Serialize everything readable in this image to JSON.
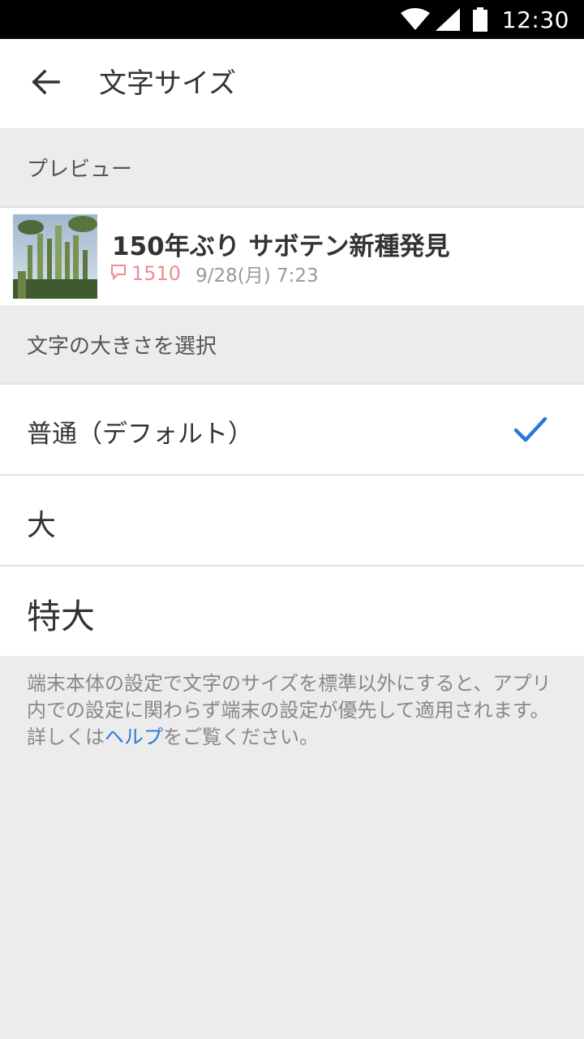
{
  "status_bar": {
    "time": "12:30",
    "icons": [
      "wifi-icon",
      "cell-signal-icon",
      "battery-icon"
    ]
  },
  "app_bar": {
    "back_icon": "arrow-left-icon",
    "title": "文字サイズ"
  },
  "preview_section": {
    "header": "プレビュー",
    "article": {
      "title": "150年ぶり サボテン新種発見",
      "comment_icon": "comment-icon",
      "comment_count": "1510",
      "date": "9/28(月) 7:23"
    }
  },
  "size_section": {
    "header": "文字の大きさを選択",
    "options": [
      {
        "label": "普通（デフォルト）",
        "selected": true
      },
      {
        "label": "大",
        "selected": false
      },
      {
        "label": "特大",
        "selected": false
      }
    ],
    "check_icon": "checkmark-icon"
  },
  "footnote": {
    "text_before": "端末本体の設定で文字のサイズを標準以外にすると、アプリ内での設定に関わらず端末の設定が優先して適用されます。詳しくは",
    "link": "ヘルプ",
    "text_after": "をご覧ください。"
  },
  "colors": {
    "accent": "#2a78d8",
    "comment": "#f08a94",
    "background": "#ececec"
  }
}
